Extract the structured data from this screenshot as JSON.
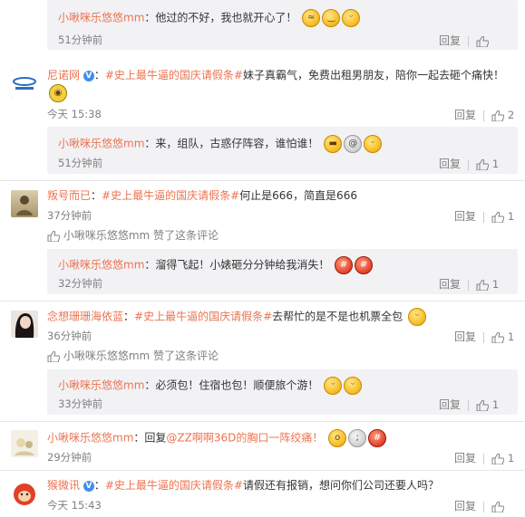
{
  "labels": {
    "reply": "回复",
    "liked_suffix": "赞了这条评论"
  },
  "colors": {
    "accent": "#eb7350",
    "reply_bg": "#f2f2f5"
  },
  "items": [
    {
      "id": "r1",
      "kind": "reply",
      "user": "小啾咪乐悠悠mm",
      "sep": "：",
      "text": "他过的不好，我也就开心了！",
      "emojis": [
        "laugh-cry-emoji",
        "smile-emoji",
        "grin-emoji"
      ],
      "time": "51分钟前",
      "likes": ""
    },
    {
      "id": "c1",
      "kind": "comment",
      "user": "尼诺网",
      "verified": true,
      "sep": "：",
      "topic": "#史上最牛逼的国庆请假条#",
      "text": "妹子真霸气，免费出租男朋友，陪你一起去砸个痛快！",
      "emojis": [
        "minion-emoji"
      ],
      "time": "今天 15:38",
      "likes": "2"
    },
    {
      "id": "r2",
      "kind": "reply",
      "user": "小啾咪乐悠悠mm",
      "sep": "：",
      "text": "来，组队，古惑仔阵容，谁怕谁！",
      "emojis": [
        "cool-emoji",
        "dizzy-emoji",
        "grin-emoji"
      ],
      "time": "51分钟前",
      "likes": "1"
    },
    {
      "id": "c2",
      "kind": "comment",
      "user": "叛号而已",
      "sep": "：",
      "topic": "#史上最牛逼的国庆请假条#",
      "text": "何止是666，简直是666",
      "emojis": [],
      "time": "37分钟前",
      "likes": "1",
      "liked_by": "小啾咪乐悠悠mm"
    },
    {
      "id": "r3",
      "kind": "reply",
      "user": "小啾咪乐悠悠mm",
      "sep": "：",
      "text": "溜得飞起！小婊砸分分钟给我消失！",
      "emojis": [
        "angry-emoji",
        "angry-emoji"
      ],
      "time": "32分钟前",
      "likes": "1"
    },
    {
      "id": "c3",
      "kind": "comment",
      "user": "念想珊珊海依蓝",
      "sep": "：",
      "topic": "#史上最牛逼的国庆请假条#",
      "text": "去帮忙的是不是也机票全包",
      "emojis": [
        "grin-emoji"
      ],
      "time": "36分钟前",
      "likes": "1",
      "liked_by": "小啾咪乐悠悠mm"
    },
    {
      "id": "r4",
      "kind": "reply",
      "user": "小啾咪乐悠悠mm",
      "sep": "：",
      "text": "必须包！住宿也包！顺便旅个游！",
      "emojis": [
        "grin-emoji",
        "grin-emoji"
      ],
      "time": "33分钟前",
      "likes": "1"
    },
    {
      "id": "c4",
      "kind": "comment",
      "user": "小啾咪乐悠悠mm",
      "sep": "：",
      "reply_prefix": "回复",
      "mention": "@ZZ啊啊36D",
      "text": "的胸口一阵绞痛！",
      "emojis": [
        "shock-emoji",
        "cry-emoji",
        "angry-emoji"
      ],
      "time": "29分钟前",
      "likes": "1"
    },
    {
      "id": "c5",
      "kind": "comment",
      "user": "猴微讯",
      "verified": true,
      "sep": "：",
      "topic": "#史上最牛逼的国庆请假条#",
      "text": "请假还有报销，想问你们公司还要人吗？",
      "emojis": [],
      "time": "今天 15:43",
      "likes": ""
    }
  ]
}
